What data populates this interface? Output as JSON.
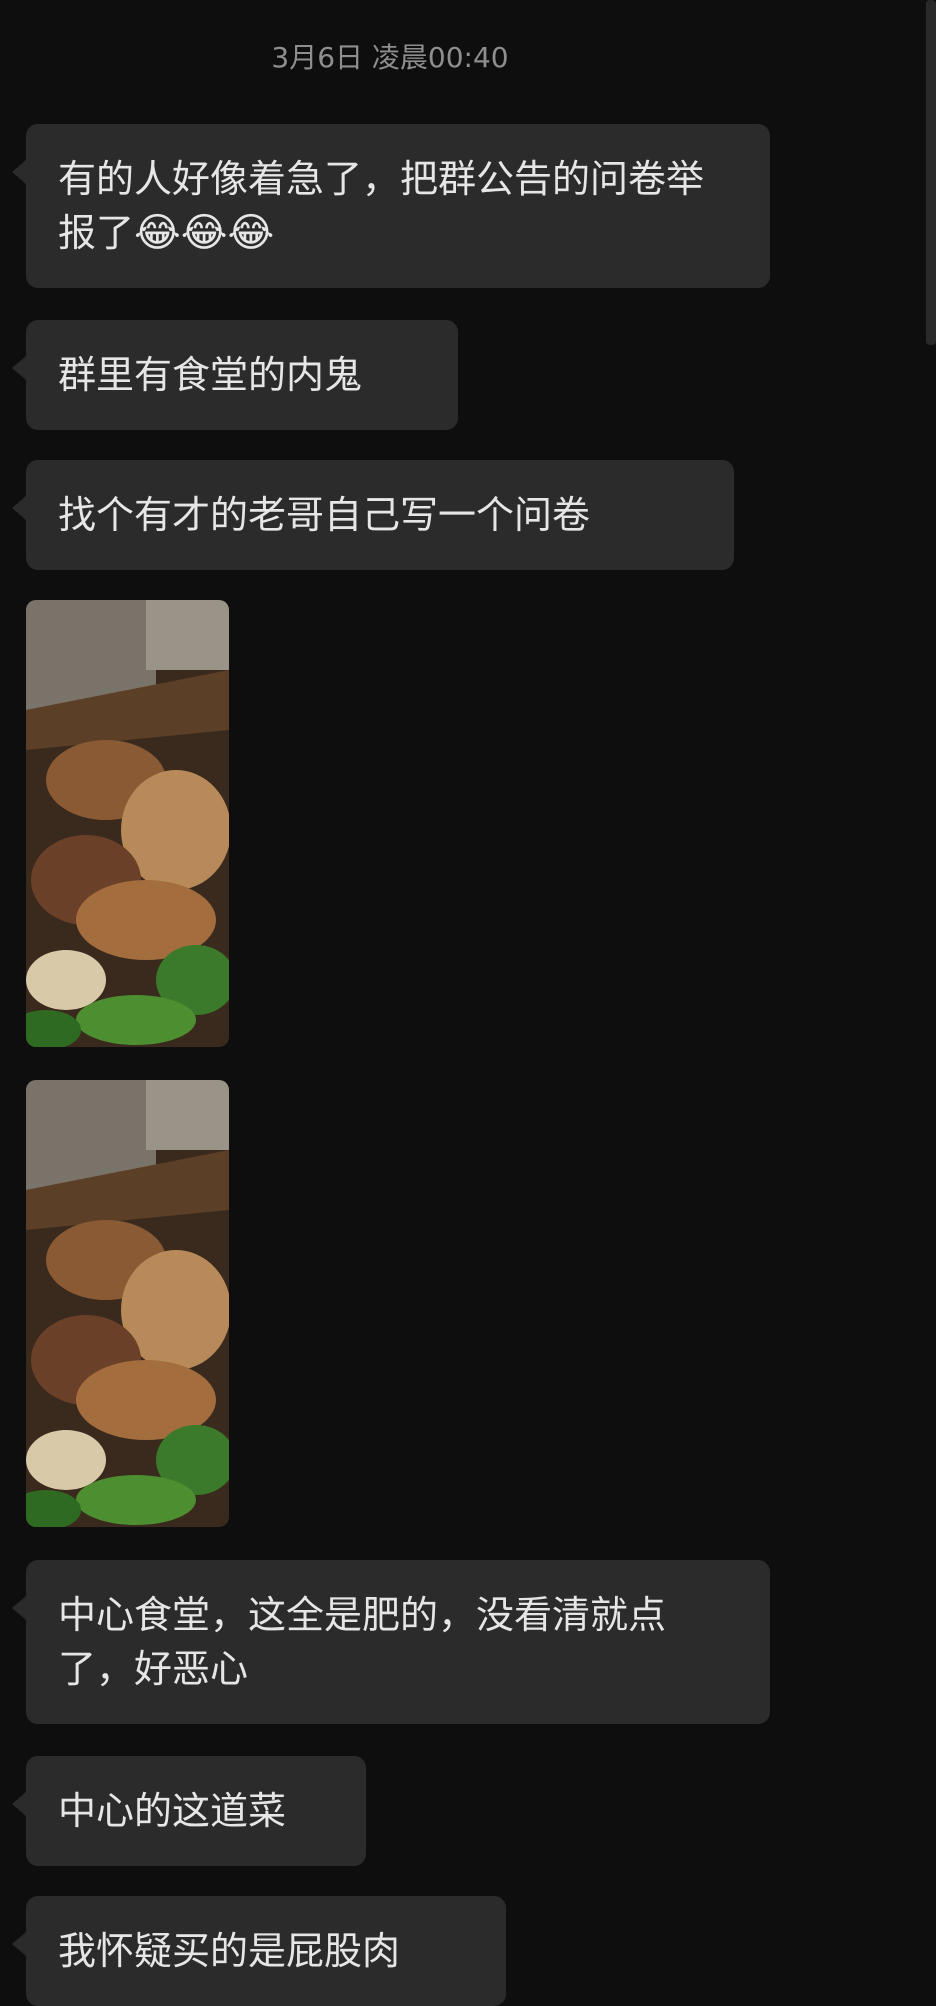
{
  "chat": {
    "timestamp": "3月6日 凌晨00:40",
    "messages": [
      {
        "type": "text",
        "text": "有的人好像着急了，把群公告的问卷举报了",
        "emoji": "😂😂😂"
      },
      {
        "type": "text",
        "text": "群里有食堂的内鬼"
      },
      {
        "type": "text",
        "text": "找个有才的老哥自己写一个问卷"
      },
      {
        "type": "image",
        "content": "food-photo"
      },
      {
        "type": "image",
        "content": "food-photo"
      },
      {
        "type": "text",
        "text": "中心食堂，这全是肥的，没看清就点了，好恶心"
      },
      {
        "type": "text",
        "text": "中心的这道菜"
      },
      {
        "type": "text",
        "text": "我怀疑买的是屁股肉"
      }
    ]
  },
  "colors": {
    "background": "#0e0e0e",
    "bubble": "#2b2b2b",
    "text": "#e6e6e6",
    "timestamp": "#8e8e8e"
  }
}
